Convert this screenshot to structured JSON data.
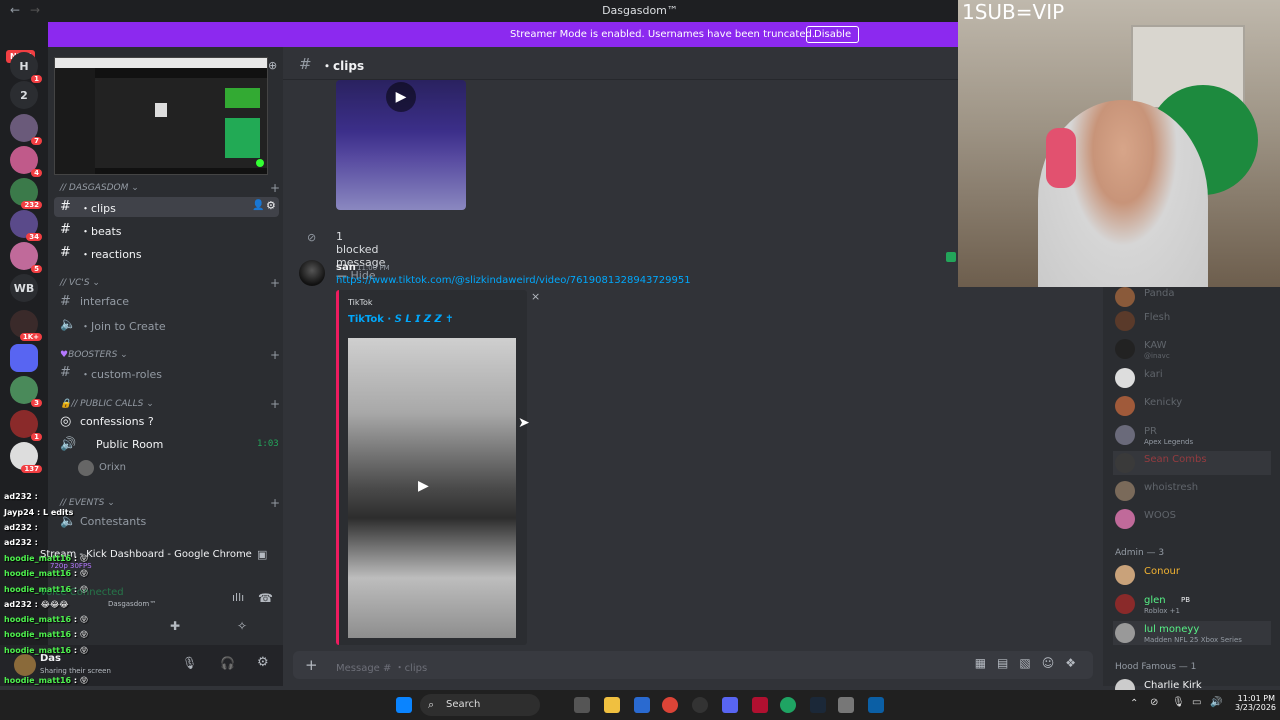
{
  "window": {
    "title": "Dasgasdom™"
  },
  "banner": {
    "text": "Streamer Mode is enabled. Usernames have been truncated.",
    "disable_label": "Disable"
  },
  "rail": {
    "new_label": "NEW",
    "items": [
      {
        "label": "H",
        "badge": "1"
      },
      {
        "label": "2",
        "badge": ""
      },
      {
        "label": "",
        "badge": "7"
      },
      {
        "label": "",
        "badge": "4"
      },
      {
        "label": "",
        "badge": "232"
      },
      {
        "label": "",
        "badge": "34"
      },
      {
        "label": "",
        "badge": "5"
      },
      {
        "label": "WB",
        "badge": ""
      },
      {
        "label": "",
        "badge": "1K+"
      },
      {
        "label": "",
        "badge": ""
      },
      {
        "label": "",
        "badge": "3"
      },
      {
        "label": "",
        "badge": "1"
      },
      {
        "label": "",
        "badge": "137"
      }
    ]
  },
  "sidebar": {
    "categories": {
      "dasgasdom": "// DASGASDOM",
      "vcs": "// Vc's",
      "boosters": "Boosters",
      "public_calls": "// PUBLIC CALLS",
      "events": "// Events"
    },
    "channels": {
      "clips": "・clips",
      "beats": "・beats",
      "reactions": "・reactions",
      "interface": "interface",
      "join_to_create": "・Join to Create",
      "custom_roles": "・custom-roles",
      "confessions": "confessions ?",
      "public_room": "Public Room",
      "public_room_time": "1:03",
      "contestants": "Contestants"
    },
    "voice_user": "Orixn"
  },
  "overlay_chat": [
    {
      "user": "ad232",
      "msg": ""
    },
    {
      "user": "Jayp24",
      "msg": "L edits"
    },
    {
      "user": "ad232",
      "msg": ""
    },
    {
      "user": "ad232",
      "msg": ""
    },
    {
      "user": "hoodie_matt16",
      "msg": "😝"
    },
    {
      "user": "hoodie_matt16",
      "msg": "😝"
    },
    {
      "user": "hoodie_matt16",
      "msg": "😝"
    },
    {
      "user": "ad232",
      "msg": "😂😂😂"
    },
    {
      "user": "hoodie_matt16",
      "msg": "😝"
    },
    {
      "user": "hoodie_matt16",
      "msg": "😝"
    },
    {
      "user": "hoodie_matt16",
      "msg": "😝"
    },
    {
      "user": "hoodie_matt16",
      "msg": "😝"
    },
    {
      "user": "hoodie_matt16",
      "msg": "😝"
    }
  ],
  "popup": {
    "title": "Stream - Kick Dashboard - Google Chrome",
    "quality": "720p 30FPS",
    "voice_status": "Voice Connected",
    "server": "Dasgasdom™"
  },
  "user_panel": {
    "name": "Das",
    "status": "Sharing their screen"
  },
  "chat": {
    "channel": "clips",
    "blocked": "1 blocked message",
    "hide": "Hide",
    "message": {
      "author": "san",
      "time": "11:00 PM",
      "link": "https://www.tiktok.com/@slizkindaweird/video/7619081328943729951",
      "embed_provider": "TikTok",
      "embed_title": "TikTok · 𝙎 𝙇 𝙄 𝙕 𝙕 ✝"
    },
    "input_placeholder": "Message # ・clips"
  },
  "webcam": {
    "label": "1SUB=VIP"
  },
  "members": {
    "items": [
      {
        "name": "Panda",
        "status": "",
        "online": false
      },
      {
        "name": "Flesh",
        "status": "",
        "online": false
      },
      {
        "name": "KAW",
        "status": "@inavc",
        "online": false
      },
      {
        "name": "kari",
        "status": "",
        "online": false
      },
      {
        "name": "Kenicky",
        "status": "",
        "online": false
      },
      {
        "name": "PR",
        "status": "Apex Legends",
        "online": false
      },
      {
        "name": "Sean Combs",
        "status": "",
        "online": false
      },
      {
        "name": "whoistresh",
        "status": "",
        "online": false
      },
      {
        "name": "WOOS",
        "status": "",
        "online": false
      }
    ],
    "admin_group": "Admin — 3",
    "admins": [
      {
        "name": "Conour",
        "status": "",
        "color": "#f0b232"
      },
      {
        "name": "glen",
        "status": "Roblox +1",
        "color": "#57f287",
        "badge": "PB"
      },
      {
        "name": "lul moneyy",
        "status": "Madden NFL 25 Xbox Series",
        "color": "#57f287"
      }
    ],
    "hood_group": "Hood Famous — 1",
    "hood": [
      {
        "name": "Charlie Kirk",
        "status": "",
        "color": "#f2f3f5"
      }
    ]
  },
  "taskbar": {
    "search": "Search",
    "time": "11:01 PM",
    "date": "3/23/2026"
  }
}
